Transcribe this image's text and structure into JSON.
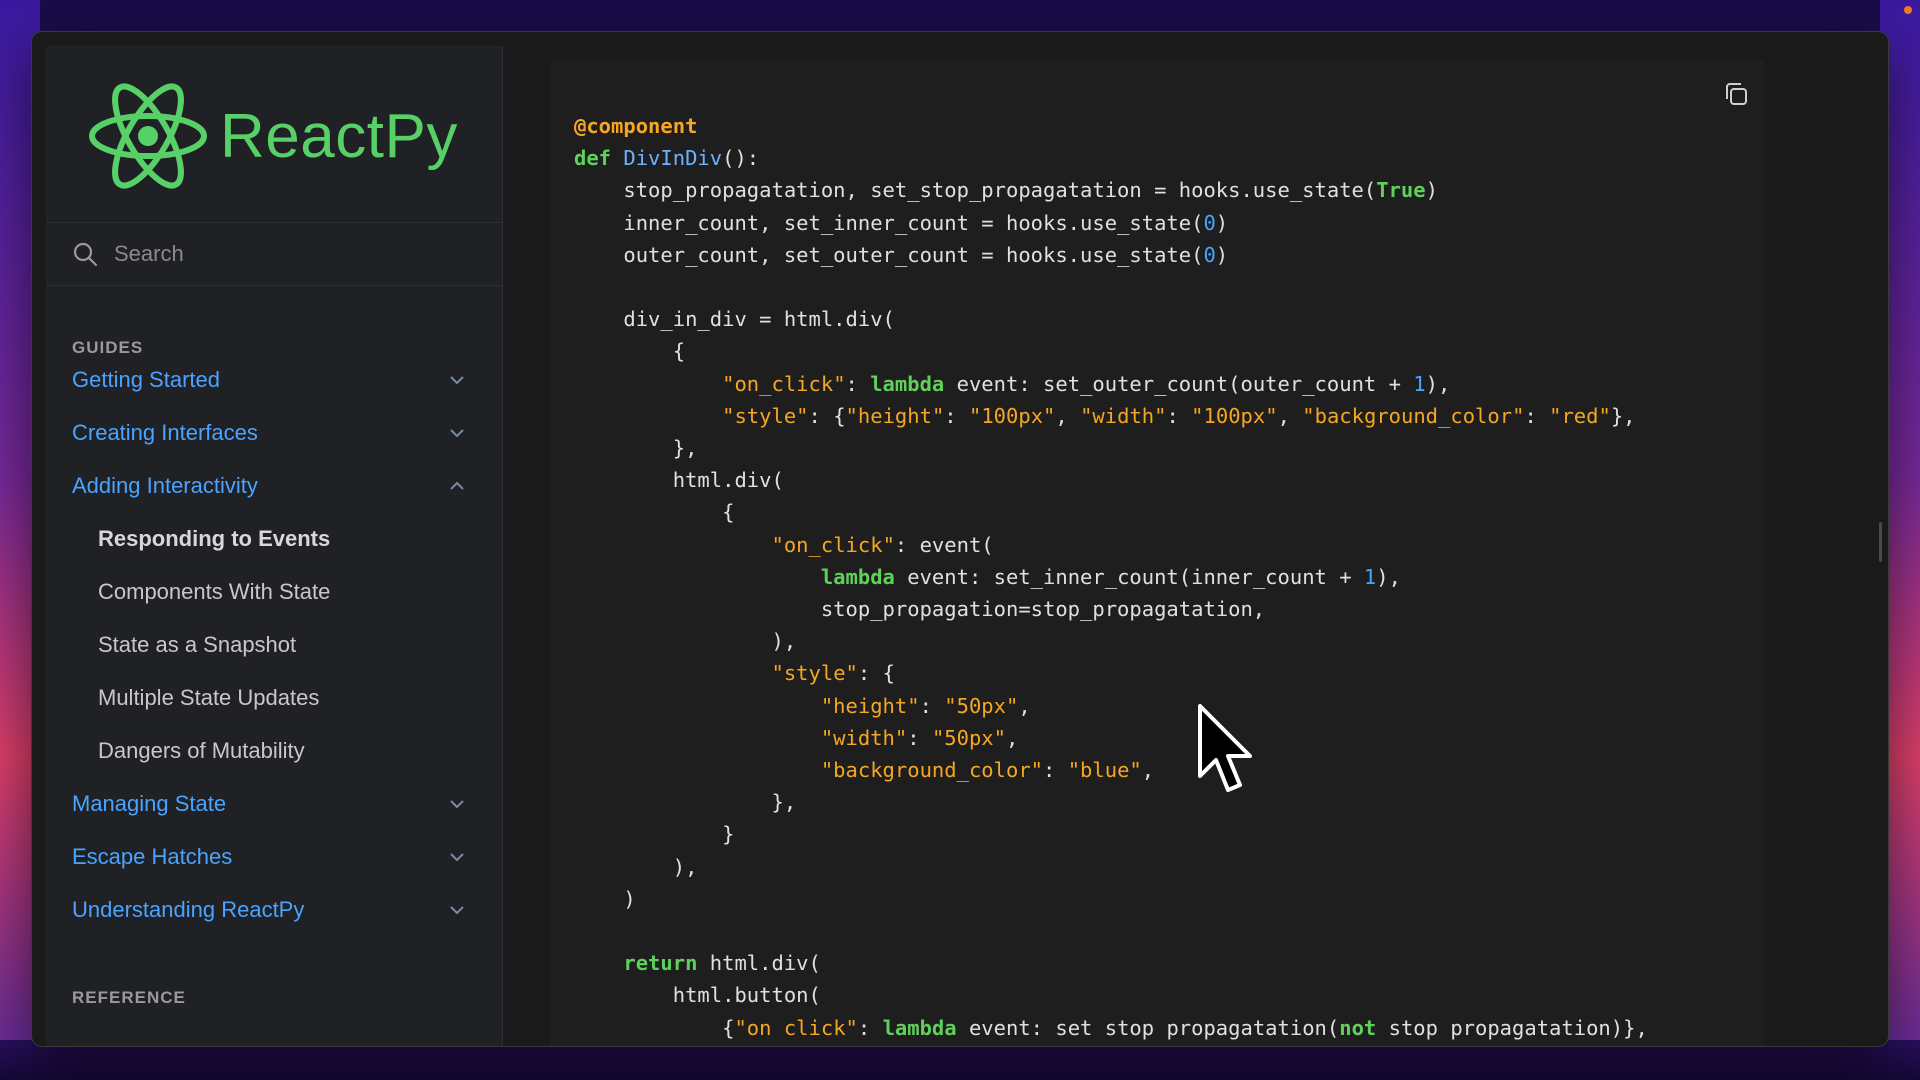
{
  "logo": {
    "text": "ReactPy",
    "icon": "react-atom-icon",
    "color": "#58d068"
  },
  "search": {
    "placeholder": "Search",
    "icon": "search-icon"
  },
  "sidebar": {
    "sections": [
      {
        "title": "GUIDES"
      },
      {
        "title": "REFERENCE"
      }
    ],
    "items": [
      {
        "label": "Getting Started",
        "expanded": false
      },
      {
        "label": "Creating Interfaces",
        "expanded": false
      },
      {
        "label": "Adding Interactivity",
        "expanded": true
      },
      {
        "label": "Managing State",
        "expanded": false
      },
      {
        "label": "Escape Hatches",
        "expanded": false
      },
      {
        "label": "Understanding ReactPy",
        "expanded": false
      }
    ],
    "subitems": [
      {
        "label": "Responding to Events",
        "active": true
      },
      {
        "label": "Components With State"
      },
      {
        "label": "State as a Snapshot"
      },
      {
        "label": "Multiple State Updates"
      },
      {
        "label": "Dangers of Mutability"
      }
    ]
  },
  "code": {
    "copy_icon": "copy-icon",
    "lines": [
      [
        [
          "d",
          "@component"
        ]
      ],
      [
        [
          "k",
          "def "
        ],
        [
          "f",
          "DivInDiv"
        ],
        [
          "t",
          "():"
        ]
      ],
      [
        [
          "t",
          "    stop_propagatation, set_stop_propagatation = hooks.use_state("
        ],
        [
          "k",
          "True"
        ],
        [
          "t",
          ")"
        ]
      ],
      [
        [
          "t",
          "    inner_count, set_inner_count = hooks.use_state("
        ],
        [
          "n",
          "0"
        ],
        [
          "t",
          ")"
        ]
      ],
      [
        [
          "t",
          "    outer_count, set_outer_count = hooks.use_state("
        ],
        [
          "n",
          "0"
        ],
        [
          "t",
          ")"
        ]
      ],
      [
        [
          "t",
          ""
        ]
      ],
      [
        [
          "t",
          "    div_in_div = html.div("
        ]
      ],
      [
        [
          "t",
          "        {"
        ]
      ],
      [
        [
          "t",
          "            "
        ],
        [
          "s",
          "\"on_click\""
        ],
        [
          "t",
          ": "
        ],
        [
          "k",
          "lambda"
        ],
        [
          "t",
          " event: set_outer_count(outer_count + "
        ],
        [
          "n",
          "1"
        ],
        [
          "t",
          "),"
        ]
      ],
      [
        [
          "t",
          "            "
        ],
        [
          "s",
          "\"style\""
        ],
        [
          "t",
          ": {"
        ],
        [
          "s",
          "\"height\""
        ],
        [
          "t",
          ": "
        ],
        [
          "s",
          "\"100px\""
        ],
        [
          "t",
          ", "
        ],
        [
          "s",
          "\"width\""
        ],
        [
          "t",
          ": "
        ],
        [
          "s",
          "\"100px\""
        ],
        [
          "t",
          ", "
        ],
        [
          "s",
          "\"background_color\""
        ],
        [
          "t",
          ": "
        ],
        [
          "s",
          "\"red\""
        ],
        [
          "t",
          "},"
        ]
      ],
      [
        [
          "t",
          "        },"
        ]
      ],
      [
        [
          "t",
          "        html.div("
        ]
      ],
      [
        [
          "t",
          "            {"
        ]
      ],
      [
        [
          "t",
          "                "
        ],
        [
          "s",
          "\"on_click\""
        ],
        [
          "t",
          ": event("
        ]
      ],
      [
        [
          "t",
          "                    "
        ],
        [
          "k",
          "lambda"
        ],
        [
          "t",
          " event: set_inner_count(inner_count + "
        ],
        [
          "n",
          "1"
        ],
        [
          "t",
          "),"
        ]
      ],
      [
        [
          "t",
          "                    stop_propagation=stop_propagatation,"
        ]
      ],
      [
        [
          "t",
          "                ),"
        ]
      ],
      [
        [
          "t",
          "                "
        ],
        [
          "s",
          "\"style\""
        ],
        [
          "t",
          ": {"
        ]
      ],
      [
        [
          "t",
          "                    "
        ],
        [
          "s",
          "\"height\""
        ],
        [
          "t",
          ": "
        ],
        [
          "s",
          "\"50px\""
        ],
        [
          "t",
          ","
        ]
      ],
      [
        [
          "t",
          "                    "
        ],
        [
          "s",
          "\"width\""
        ],
        [
          "t",
          ": "
        ],
        [
          "s",
          "\"50px\""
        ],
        [
          "t",
          ","
        ]
      ],
      [
        [
          "t",
          "                    "
        ],
        [
          "s",
          "\"background_color\""
        ],
        [
          "t",
          ": "
        ],
        [
          "s",
          "\"blue\""
        ],
        [
          "t",
          ","
        ]
      ],
      [
        [
          "t",
          "                },"
        ]
      ],
      [
        [
          "t",
          "            }"
        ]
      ],
      [
        [
          "t",
          "        ),"
        ]
      ],
      [
        [
          "t",
          "    )"
        ]
      ],
      [
        [
          "t",
          ""
        ]
      ],
      [
        [
          "t",
          "    "
        ],
        [
          "k",
          "return"
        ],
        [
          "t",
          " html.div("
        ]
      ],
      [
        [
          "t",
          "        html.button("
        ]
      ],
      [
        [
          "t",
          "            {"
        ],
        [
          "s",
          "\"on click\""
        ],
        [
          "t",
          ": "
        ],
        [
          "k",
          "lambda"
        ],
        [
          "t",
          " event: set stop propagatation("
        ],
        [
          "k",
          "not"
        ],
        [
          "t",
          " stop propagatation)},"
        ]
      ]
    ]
  }
}
